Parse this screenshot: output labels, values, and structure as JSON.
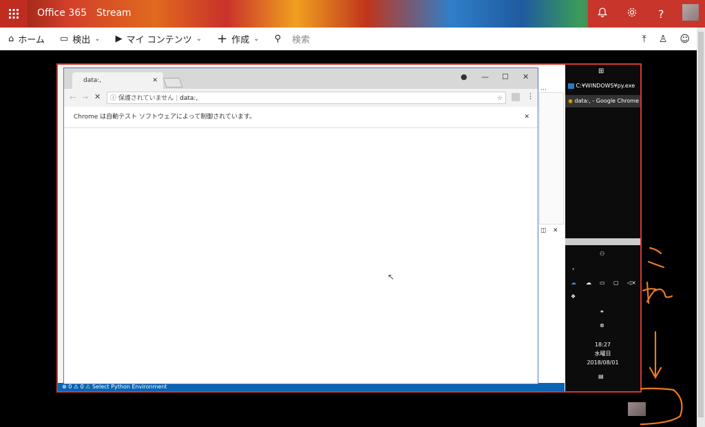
{
  "header": {
    "office_label": "Office 365",
    "app_label": "Stream",
    "icons": [
      "bell-icon",
      "gear-icon",
      "help-icon",
      "avatar"
    ],
    "help_glyph": "?",
    "accent": "#c8352a"
  },
  "toolbar": {
    "home": "ホーム",
    "discover": "検出",
    "my_content": "マイ コンテンツ",
    "create": "作成",
    "search_placeholder": "検索"
  },
  "chrome": {
    "tab_title": "data:,",
    "security_label": "保護されていません",
    "url": "data:,",
    "infobar_text": "Chrome は自動テスト ソフトウェアによって制御されています。"
  },
  "vscode": {
    "status_errors": "0",
    "status_warnings": "0",
    "status_text": "Select Python Environment"
  },
  "taskbar_jump": {
    "item1": "C:¥WINDOWS¥py.exe",
    "item2": "data:, - Google Chrome"
  },
  "clock": {
    "time": "18:27",
    "day": "水曜日",
    "date": "2018/08/01"
  },
  "annotation": {
    "text": "これ"
  }
}
